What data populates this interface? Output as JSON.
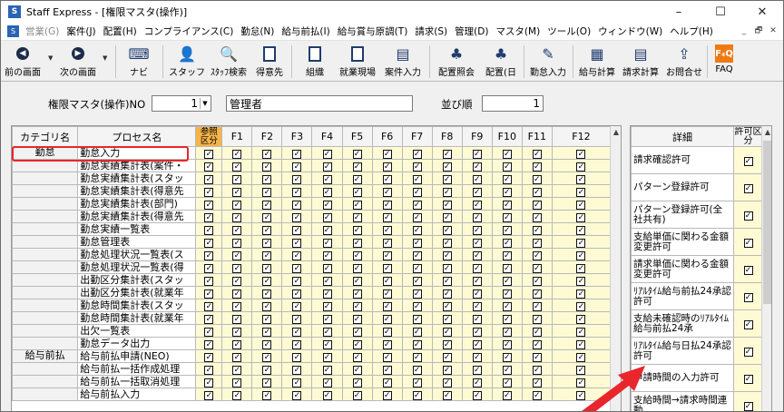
{
  "window": {
    "title": "Staff Express - [権限マスタ(操作)]",
    "app_icon": "S"
  },
  "controls": {
    "minimize": "–",
    "maximize": "☐",
    "close": "✕"
  },
  "menu": {
    "icon": "S",
    "items": [
      {
        "label": "営業(G)",
        "disabled": true
      },
      {
        "label": "案件(J)"
      },
      {
        "label": "配置(H)"
      },
      {
        "label": "コンプライアンス(C)"
      },
      {
        "label": "勤怠(N)"
      },
      {
        "label": "給与前払(I)"
      },
      {
        "label": "給与賞与原調(T)"
      },
      {
        "label": "請求(S)"
      },
      {
        "label": "管理(D)"
      },
      {
        "label": "マスタ(M)"
      },
      {
        "label": "ツール(O)"
      },
      {
        "label": "ウィンドウ(W)"
      },
      {
        "label": "ヘルプ(H)"
      }
    ],
    "mdi": [
      "_",
      "🗗",
      "✕"
    ]
  },
  "toolbar": {
    "prev": "前の画面",
    "next": "次の画面",
    "navi": "ナビ",
    "staff": "スタッフ",
    "staff_search": "ｽﾀｯﾌ検索",
    "client": "得意先",
    "org": "組織",
    "site": "就業現場",
    "job_input": "案件入力",
    "assign_ref": "配置照会",
    "assign_day": "配置(日",
    "attendance": "勤怠入力",
    "pay_calc": "給与計算",
    "bill_calc": "請求計算",
    "inquiry": "お問合せ",
    "faq": "FAQ",
    "faq_icon": "F₄Q"
  },
  "form": {
    "no_label": "権限マスタ(操作)NO",
    "no_value": "1",
    "name_value": "管理者",
    "order_label": "並び順",
    "order_value": "1"
  },
  "grid": {
    "headers": {
      "category": "カテゴリ名",
      "process": "プロセス名",
      "ref": "参照区分",
      "f": [
        "F1",
        "F2",
        "F3",
        "F4",
        "F5",
        "F6",
        "F7",
        "F8",
        "F9",
        "F10",
        "F11",
        "F12"
      ]
    },
    "rows": [
      {
        "cat": "勤怠",
        "proc": "勤怠入力"
      },
      {
        "cat": "",
        "proc": "勤怠実績集計表(案件・"
      },
      {
        "cat": "",
        "proc": "勤怠実績集計表(スタッ"
      },
      {
        "cat": "",
        "proc": "勤怠実績集計表(得意先"
      },
      {
        "cat": "",
        "proc": "勤怠実績集計表(部門)"
      },
      {
        "cat": "",
        "proc": "勤怠実績集計表(得意先"
      },
      {
        "cat": "",
        "proc": "勤怠実績一覧表"
      },
      {
        "cat": "",
        "proc": "勤怠管理表"
      },
      {
        "cat": "",
        "proc": "勤怠処理状況一覧表(ス"
      },
      {
        "cat": "",
        "proc": "勤怠処理状況一覧表(得"
      },
      {
        "cat": "",
        "proc": "出勤区分集計表(スタッ"
      },
      {
        "cat": "",
        "proc": "出勤区分集計表(就業年"
      },
      {
        "cat": "",
        "proc": "勤怠時間集計表(スタッ"
      },
      {
        "cat": "",
        "proc": "勤怠時間集計表(就業年"
      },
      {
        "cat": "",
        "proc": "出欠一覧表"
      },
      {
        "cat": "",
        "proc": "勤怠データ出力"
      },
      {
        "cat": "給与前払",
        "proc": "給与前払申請(NEO)"
      },
      {
        "cat": "",
        "proc": "給与前払一括作成処理"
      },
      {
        "cat": "",
        "proc": "給与前払一括取消処理"
      },
      {
        "cat": "",
        "proc": "給与前払入力"
      }
    ],
    "check_mark": "✓"
  },
  "side": {
    "headers": {
      "detail": "詳細",
      "perm": "許可区分"
    },
    "rows": [
      "請求確認許可",
      "パターン登録許可",
      "パターン登録許可(全社共有)",
      "支給単価に関わる金額変更許可",
      "請求単価に関わる金額変更許可",
      "ﾘｱﾙﾀｲﾑ給与前払24承認許可",
      "支給未確認時のﾘｱﾙﾀｲﾑ給与前払24承",
      "ﾘｱﾙﾀｲﾑ給与日払24承認許可",
      "申請時間の入力許可",
      "支給時間→請求時間連動"
    ]
  },
  "colors": {
    "highlight_header": "#f5b44a",
    "checkbox_bg": "#fefbd4",
    "annotation_red": "#e8262c"
  }
}
